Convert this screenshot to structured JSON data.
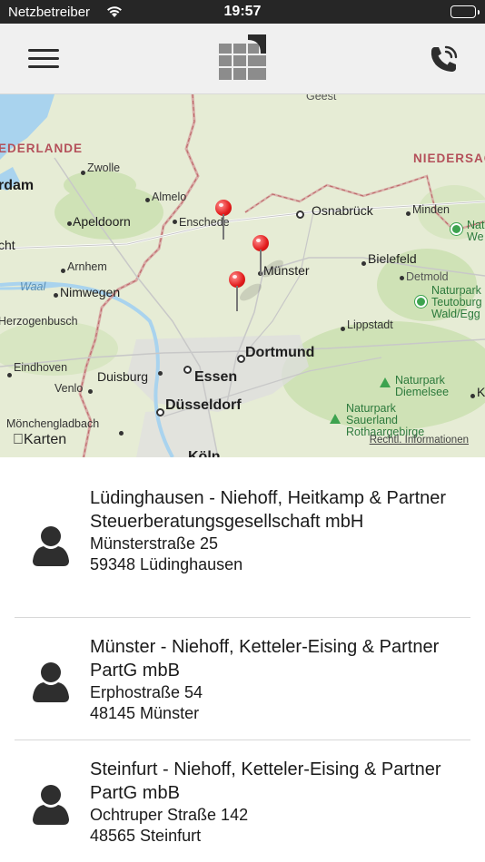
{
  "status_bar": {
    "carrier": "Netzbetreiber",
    "time": "19:57",
    "wifi_icon": "wifi-icon",
    "battery_icon": "battery-icon"
  },
  "nav": {
    "menu_icon": "hamburger-menu-icon",
    "logo_icon": "grid-logo-icon",
    "phone_icon": "phone-call-icon"
  },
  "map": {
    "attribution": "Karten",
    "legal_link": "Rechtl. Informationen",
    "labels": {
      "geest": "Geest",
      "nederlande": "EDERLANDE",
      "niedersa": "NIEDERSAC",
      "zwolle": "Zwolle",
      "rdam": "rdam",
      "almelo": "Almelo",
      "apeldoorn": "Apeldoorn",
      "enschede": "Enschede",
      "osnabrueck": "Osnabrück",
      "minden": "Minden",
      "nat_we": "Nat\nWe",
      "cht": "cht",
      "bielefeld": "Bielefeld",
      "muenster": "Münster",
      "arnhem": "Arnhem",
      "waal": "Waal",
      "detmold": "Detmold",
      "nimwegen": "Nimwegen",
      "naturpark_teutoburg": "Naturpark\nTeutoburg\nWald/Egg",
      "herzogenbusch": "Herzogenbusch",
      "lippstadt": "Lippstadt",
      "dortmund": "Dortmund",
      "eindhoven": "Eindhoven",
      "duisburg": "Duisburg",
      "essen": "Essen",
      "naturpark_diemelsee": "Naturpark\nDiemelsee",
      "venlo": "Venlo",
      "k": "K",
      "duesseldorf": "Düsseldorf",
      "naturpark_sauerland": "Naturpark\nSauerland\nRothaargebirge",
      "moenchengladbach": "Mönchengladbach",
      "koeln": "Köln"
    },
    "pins": [
      "Enschede area pin",
      "Münster area pin",
      "Lüdinghausen area pin"
    ],
    "pin_icon": "map-pin-icon"
  },
  "offices": [
    {
      "name": "Lüdinghausen - Niehoff, Heitkamp & Partner Steuerberatungsgesellschaft mbH",
      "street": "Münsterstraße 25",
      "city": "59348 Lüdinghausen",
      "icon": "person-avatar-icon"
    },
    {
      "name": "Münster - Niehoff, Ketteler-Eising & Partner PartG mbB",
      "street": "Erphostraße 54",
      "city": "48145 Münster",
      "icon": "person-avatar-icon"
    },
    {
      "name": "Steinfurt - Niehoff, Ketteler-Eising & Partner PartG mbB",
      "street": "Ochtruper Straße 142",
      "city": "48565 Steinfurt",
      "icon": "person-avatar-icon"
    }
  ],
  "colors": {
    "status_bar": "#262626",
    "nav_bar": "#f0f0f0",
    "pin": "#e21b1b",
    "map_land": "#e6ecd5",
    "map_forest": "#cfe2b6"
  }
}
